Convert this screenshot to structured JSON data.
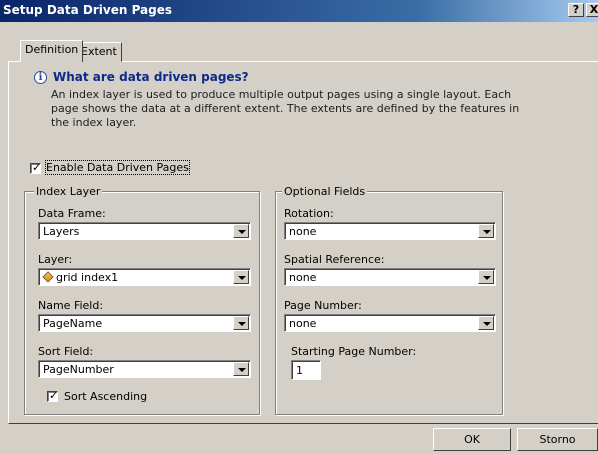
{
  "window": {
    "title": "Setup Data Driven Pages",
    "help_label": "?",
    "close_label": "X"
  },
  "tabs": [
    "Definition",
    "Extent"
  ],
  "info": {
    "title": "What are data driven pages?",
    "description": "An index layer is used to produce multiple output pages using a single layout.  Each page shows the data at a different extent.  The extents are defined by the features in the index layer."
  },
  "enable": {
    "label": "Enable Data Driven Pages",
    "checked": true
  },
  "index_layer": {
    "legend": "Index Layer",
    "data_frame": {
      "label": "Data Frame:",
      "value": "Layers"
    },
    "layer": {
      "label": "Layer:",
      "value": "grid index1",
      "icon": "polygon-layer-icon"
    },
    "name_field": {
      "label": "Name Field:",
      "value": "PageName"
    },
    "sort_field": {
      "label": "Sort Field:",
      "value": "PageNumber"
    },
    "sort_ascending": {
      "label": "Sort Ascending",
      "checked": true
    }
  },
  "optional_fields": {
    "legend": "Optional Fields",
    "rotation": {
      "label": "Rotation:",
      "value": "none"
    },
    "spatial_reference": {
      "label": "Spatial Reference:",
      "value": "none"
    },
    "page_number": {
      "label": "Page Number:",
      "value": "none"
    },
    "starting_page_number": {
      "label": "Starting Page Number:",
      "value": "1"
    }
  },
  "buttons": {
    "ok": "OK",
    "cancel": "Storno"
  }
}
